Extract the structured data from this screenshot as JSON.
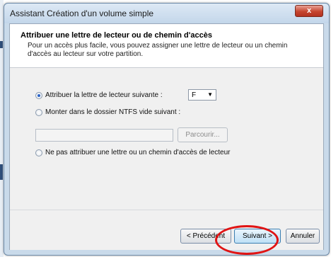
{
  "window": {
    "title": "Assistant Création d'un volume simple",
    "close_label": "x"
  },
  "header": {
    "title": "Attribuer une lettre de lecteur ou de chemin d'accès",
    "description": "Pour un accès plus facile, vous pouvez assigner une lettre de lecteur ou un chemin d'accès au lecteur sur votre partition."
  },
  "options": {
    "assign_letter_label": "Attribuer la lettre de lecteur suivante :",
    "mount_ntfs_label": "Monter dans le dossier NTFS vide suivant :",
    "no_letter_label": "Ne pas attribuer une lettre ou un chemin d'accès de lecteur",
    "selected": "assign_letter"
  },
  "drive_letter": {
    "value": "F"
  },
  "ntfs_path": {
    "value": ""
  },
  "buttons": {
    "browse": "Parcourir...",
    "back": "< Précédent",
    "next": "Suivant >",
    "cancel": "Annuler"
  },
  "colors": {
    "annotation": "#e01414",
    "accent": "#2b63c7"
  }
}
